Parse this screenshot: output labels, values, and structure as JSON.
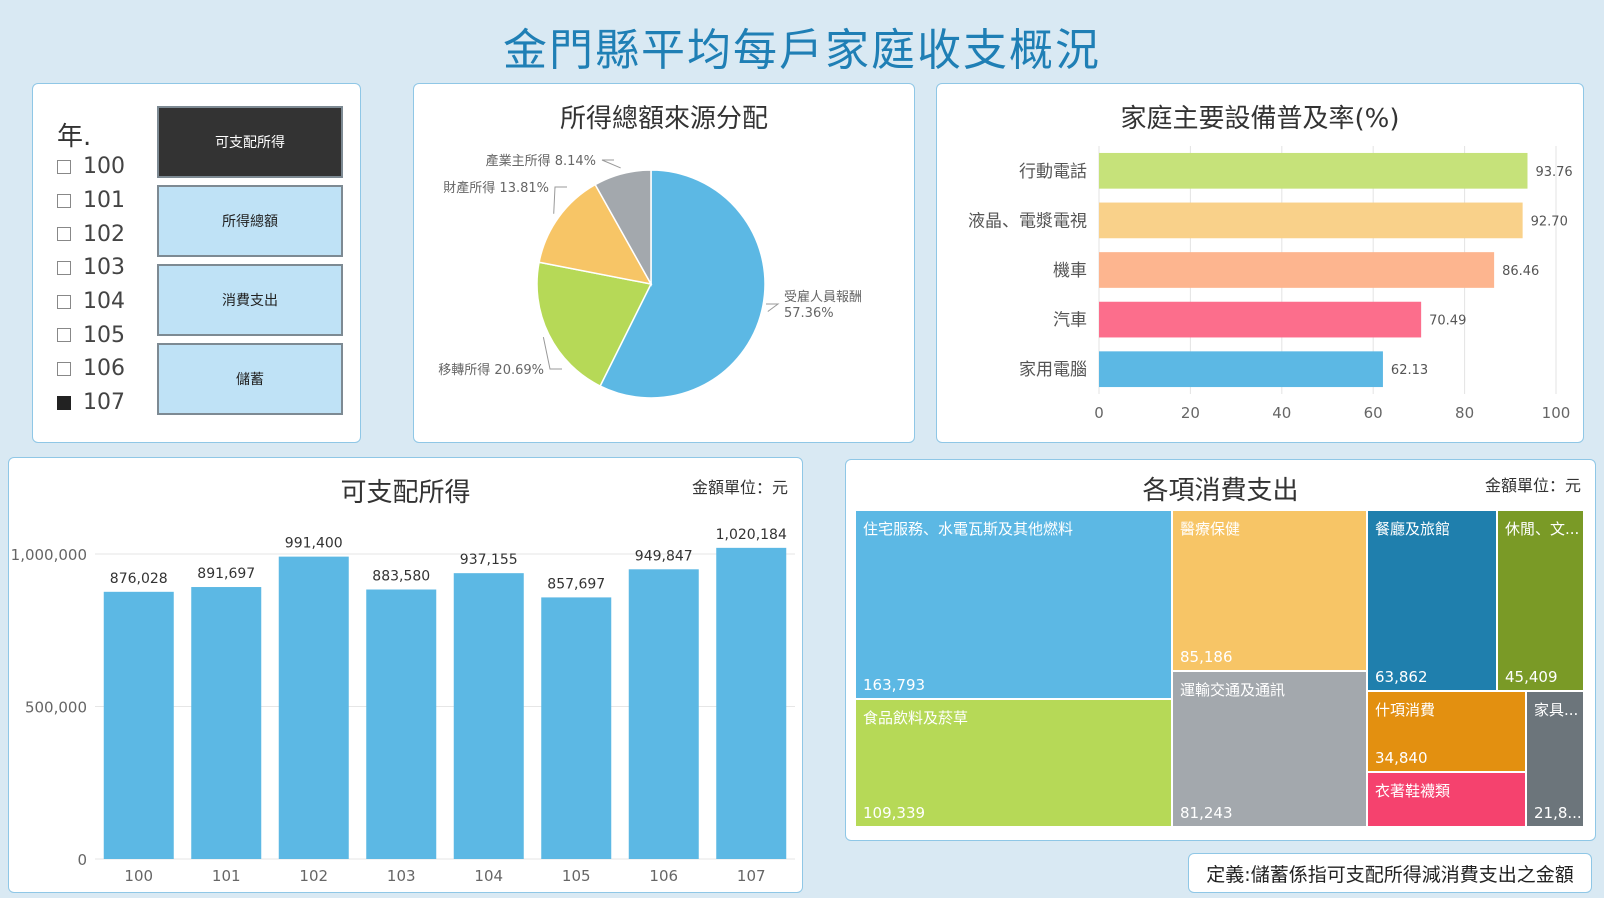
{
  "title": "金門縣平均每戶家庭收支概況",
  "slicer": {
    "title": "年.",
    "years": [
      {
        "label": "100",
        "checked": false
      },
      {
        "label": "101",
        "checked": false
      },
      {
        "label": "102",
        "checked": false
      },
      {
        "label": "103",
        "checked": false
      },
      {
        "label": "104",
        "checked": false
      },
      {
        "label": "105",
        "checked": false
      },
      {
        "label": "106",
        "checked": false
      },
      {
        "label": "107",
        "checked": true
      }
    ]
  },
  "buttons": [
    {
      "label": "可支配所得",
      "active": true
    },
    {
      "label": "所得總額",
      "active": false
    },
    {
      "label": "消費支出",
      "active": false
    },
    {
      "label": "儲蓄",
      "active": false
    }
  ],
  "footnote": "定義:儲蓄係指可支配所得減消費支出之金額",
  "colors": {
    "accent": "#1f7fb5",
    "bar_blue": "#5cb8e4",
    "panel_border": "#8fc7e6"
  },
  "chart_data": [
    {
      "type": "pie",
      "title": "所得總額來源分配",
      "slices": [
        {
          "name": "受雇人員報酬",
          "value": 57.36,
          "label": "57.36%",
          "color": "#5cb8e4"
        },
        {
          "name": "移轉所得",
          "value": 20.69,
          "label": "20.69%",
          "color": "#b6d957"
        },
        {
          "name": "財產所得",
          "value": 13.81,
          "label": "13.81%",
          "color": "#f7c566"
        },
        {
          "name": "產業主所得",
          "value": 8.14,
          "label": "8.14%",
          "color": "#a3a8ad"
        }
      ]
    },
    {
      "type": "bar",
      "orientation": "horizontal",
      "title": "家庭主要設備普及率(%)",
      "categories": [
        "行動電話",
        "液晶、電漿電視",
        "機車",
        "汽車",
        "家用電腦"
      ],
      "values": [
        93.76,
        92.7,
        86.46,
        70.49,
        62.13
      ],
      "value_labels": [
        "93.76",
        "92.70",
        "86.46",
        "70.49",
        "62.13"
      ],
      "colors": [
        "#c6e27a",
        "#f9d18a",
        "#fdb58f",
        "#fc6e8c",
        "#5cb8e4"
      ],
      "xlim": [
        0,
        100
      ],
      "xticks": [
        0,
        20,
        40,
        60,
        80,
        100
      ]
    },
    {
      "type": "bar",
      "title": "可支配所得",
      "unit_note": "金額單位：元",
      "categories": [
        "100",
        "101",
        "102",
        "103",
        "104",
        "105",
        "106",
        "107"
      ],
      "values": [
        876028,
        891697,
        991400,
        883580,
        937155,
        857697,
        949847,
        1020184
      ],
      "value_labels": [
        "876,028",
        "891,697",
        "991,400",
        "883,580",
        "937,155",
        "857,697",
        "949,847",
        "1,020,184"
      ],
      "ylim": [
        0,
        1000000
      ],
      "yticks": [
        0,
        500000,
        1000000
      ],
      "ytick_labels": [
        "0",
        "500,000",
        "1,000,000"
      ]
    },
    {
      "type": "treemap",
      "title": "各項消費支出",
      "unit_note": "金額單位：元",
      "items": [
        {
          "name": "住宅服務、水電瓦斯及其他燃料",
          "value": 163793,
          "label": "163,793",
          "color": "#5cb8e4"
        },
        {
          "name": "食品飲料及菸草",
          "value": 109339,
          "label": "109,339",
          "color": "#b6d957"
        },
        {
          "name": "醫療保健",
          "value": 85186,
          "label": "85,186",
          "color": "#f7c566"
        },
        {
          "name": "運輸交通及通訊",
          "value": 81243,
          "label": "81,243",
          "color": "#a3a8ad"
        },
        {
          "name": "餐廳及旅館",
          "value": 63862,
          "label": "63,862",
          "color": "#1f7fad"
        },
        {
          "name": "休閒、文...",
          "value": 45409,
          "label": "45,409",
          "color": "#7a9a26"
        },
        {
          "name": "什項消費",
          "value": 34840,
          "label": "34,840",
          "color": "#e39010"
        },
        {
          "name": "衣著鞋襪類",
          "value": null,
          "label": "",
          "color": "#f5426e"
        },
        {
          "name": "家具...",
          "value": null,
          "label": "21,8...",
          "color": "#6c757b"
        }
      ]
    }
  ]
}
